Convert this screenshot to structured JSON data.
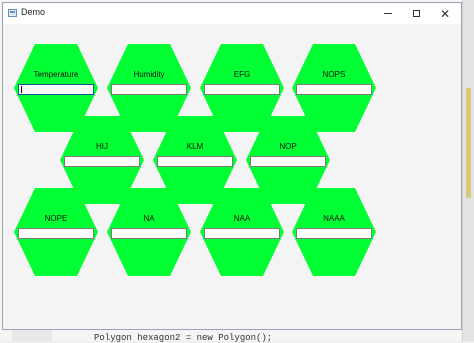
{
  "window": {
    "title": "Demo",
    "app_icon": "window-icon",
    "controls": {
      "minimize": "minimize-icon",
      "maximize": "maximize-icon",
      "close": "close-icon"
    }
  },
  "hexagons": [
    {
      "label": "Temperature",
      "value": ""
    },
    {
      "label": "Humidity",
      "value": ""
    },
    {
      "label": "EFG",
      "value": ""
    },
    {
      "label": "NOPS",
      "value": ""
    },
    {
      "label": "HIJ",
      "value": ""
    },
    {
      "label": "KLM",
      "value": ""
    },
    {
      "label": "NOP",
      "value": ""
    },
    {
      "label": "NOPE",
      "value": ""
    },
    {
      "label": "NA",
      "value": ""
    },
    {
      "label": "NAA",
      "value": ""
    },
    {
      "label": "NAAA",
      "value": ""
    }
  ],
  "colors": {
    "hex_fill": "#00ff33"
  },
  "background": {
    "code_line": "Polygon hexagon2 = new Polygon();"
  }
}
